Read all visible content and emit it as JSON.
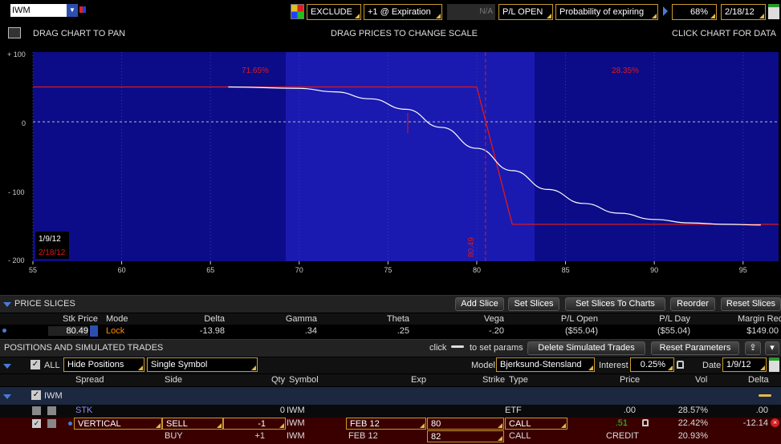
{
  "toolbar": {
    "symbol": "IWM",
    "exclude": "EXCLUDE",
    "expiration": "+1 @ Expiration",
    "na": "N/A",
    "pl_mode": "P/L OPEN",
    "probability": "Probability of expiring",
    "prob_value": "68%",
    "date": "2/18/12"
  },
  "chart_header": {
    "left": "DRAG CHART TO PAN",
    "center": "DRAG PRICES TO CHANGE SCALE",
    "right": "CLICK CHART FOR DATA"
  },
  "chart": {
    "left_pct": "71.65%",
    "right_pct": "28.35%",
    "price_line": "80.49",
    "date1": "1/9/12",
    "date2": "2/18/12",
    "y_ticks": [
      "+ 100",
      "0",
      "- 100",
      "- 200"
    ],
    "x_ticks": [
      "55",
      "60",
      "65",
      "70",
      "75",
      "80",
      "85",
      "90",
      "95"
    ],
    "colors": {
      "plot_bg": "#0c0c88",
      "band_bg": "#1a1ab0",
      "expiry": "#e01818",
      "today": "#ffffff"
    }
  },
  "chart_data": {
    "type": "line",
    "xlim": [
      55,
      97
    ],
    "ylim": [
      -200,
      100
    ],
    "series": [
      {
        "x": [
          55,
          80,
          82,
          97
        ],
        "y": [
          50,
          50,
          -147,
          -147
        ]
      },
      {
        "x": [
          66,
          70,
          72,
          74,
          76,
          78,
          80,
          82,
          84,
          86,
          88,
          90,
          92,
          94,
          96
        ],
        "y": [
          50,
          48,
          43,
          33,
          18,
          -8,
          -38,
          -70,
          -97,
          -117,
          -131,
          -140,
          -145,
          -147,
          -148
        ]
      }
    ]
  },
  "price_slices": {
    "title": "PRICE SLICES",
    "add": "Add Slice",
    "set": "Set Slices",
    "set_charts": "Set Slices To Charts",
    "reorder": "Reorder",
    "reset": "Reset Slices",
    "headers": [
      "Stk Price",
      "Mode",
      "Delta",
      "Gamma",
      "Theta",
      "Vega",
      "P/L Open",
      "P/L Day",
      "Margin Req"
    ],
    "row": [
      "80.49",
      "Lock",
      "-13.98",
      ".34",
      ".25",
      "-.20",
      "($55.04)",
      "($55.04)",
      "$149.00"
    ]
  },
  "positions": {
    "title": "POSITIONS AND SIMULATED TRADES",
    "click": "click",
    "to_set": "to set params",
    "delete": "Delete Simulated Trades",
    "reset_params": "Reset Parameters",
    "all": "ALL",
    "hide": "Hide Positions",
    "single": "Single Symbol",
    "model_label": "Model",
    "model": "Bjerksund-Stensland",
    "interest_label": "Interest",
    "interest": "0.25%",
    "date_label": "Date",
    "date": "1/9/12",
    "headers": [
      "Spread",
      "Side",
      "Qty",
      "Symbol",
      "Exp",
      "Strike",
      "Type",
      "Price",
      "Vol",
      "Delta"
    ],
    "group": "IWM",
    "rows": [
      {
        "spread": "STK",
        "side": "",
        "qty": "0",
        "symbol": "IWM",
        "exp": "",
        "strike": "",
        "type": "ETF",
        "price": ".00",
        "vol": "28.57%",
        "delta": ".00"
      },
      {
        "spread": "VERTICAL",
        "side": "SELL",
        "qty": "-1",
        "symbol": "IWM",
        "exp": "FEB 12",
        "strike": "80",
        "type": "CALL",
        "price": ".51",
        "vol": "22.42%",
        "delta": "-12.14"
      },
      {
        "spread": "",
        "side": "BUY",
        "qty": "+1",
        "symbol": "IWM",
        "exp": "FEB 12",
        "strike": "82",
        "type": "CALL",
        "price": "CREDIT",
        "vol": "20.93%",
        "delta": ""
      }
    ]
  }
}
